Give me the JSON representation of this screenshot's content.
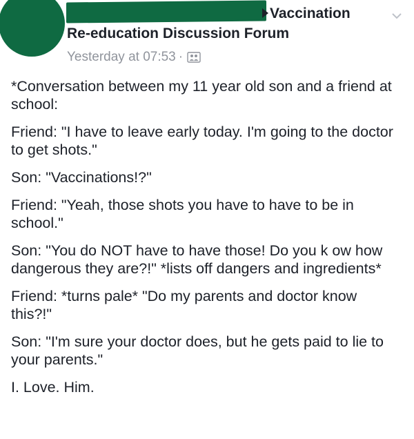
{
  "header": {
    "group_name_line1": "Vaccination",
    "group_name_line2": "Re-education Discussion Forum",
    "timestamp": "Yesterday at 07:53",
    "separator": "·",
    "audience_icon": "group-members-icon",
    "menu_icon": "chevron-down-icon"
  },
  "post": {
    "paragraphs": [
      "*Conversation between my 11 year old son and a friend at school:",
      "Friend: \"I have to leave early today. I'm going to the doctor to get shots.\"",
      "Son: \"Vaccinations!?\"",
      "Friend: \"Yeah, those shots you have to have to be in school.\"",
      "Son: \"You do NOT have to have those! Do you k ow how dangerous they are?!\" *lists off dangers and ingredients*",
      "Friend: *turns pale* \"Do my parents and doctor know this?!\"",
      "Son: \"I'm sure your doctor does, but he gets paid to lie to your parents.\"",
      "I. Love. Him."
    ]
  },
  "colors": {
    "redaction": "#0f6a42",
    "text": "#1d2129",
    "meta": "#90949c"
  }
}
